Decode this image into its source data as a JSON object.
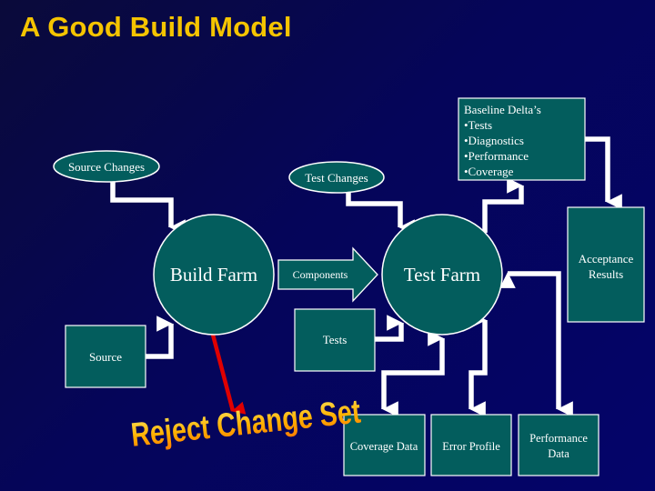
{
  "slide": {
    "title": "A Good Build Model",
    "colors": {
      "title": "#f5c400",
      "node_fill": "#035d5d",
      "node_stroke": "#ffffff",
      "connector": "#ffffff",
      "reject_arrow": "#e00000",
      "background": "#05055a"
    }
  },
  "nodes": {
    "source_changes": "Source Changes",
    "test_changes": "Test Changes",
    "baseline": {
      "heading": "Baseline Delta’s",
      "items": [
        "•Tests",
        "•Diagnostics",
        "•Performance",
        "•Coverage"
      ]
    },
    "build_farm": "Build Farm",
    "components": "Components",
    "test_farm": "Test Farm",
    "acceptance_results": [
      "Acceptance",
      "Results"
    ],
    "tests": "Tests",
    "source": "Source",
    "coverage_data": "Coverage Data",
    "error_profile": "Error Profile",
    "performance_data": [
      "Performance",
      "Data"
    ]
  },
  "callout": {
    "reject_change_set": "Reject Change Set"
  }
}
